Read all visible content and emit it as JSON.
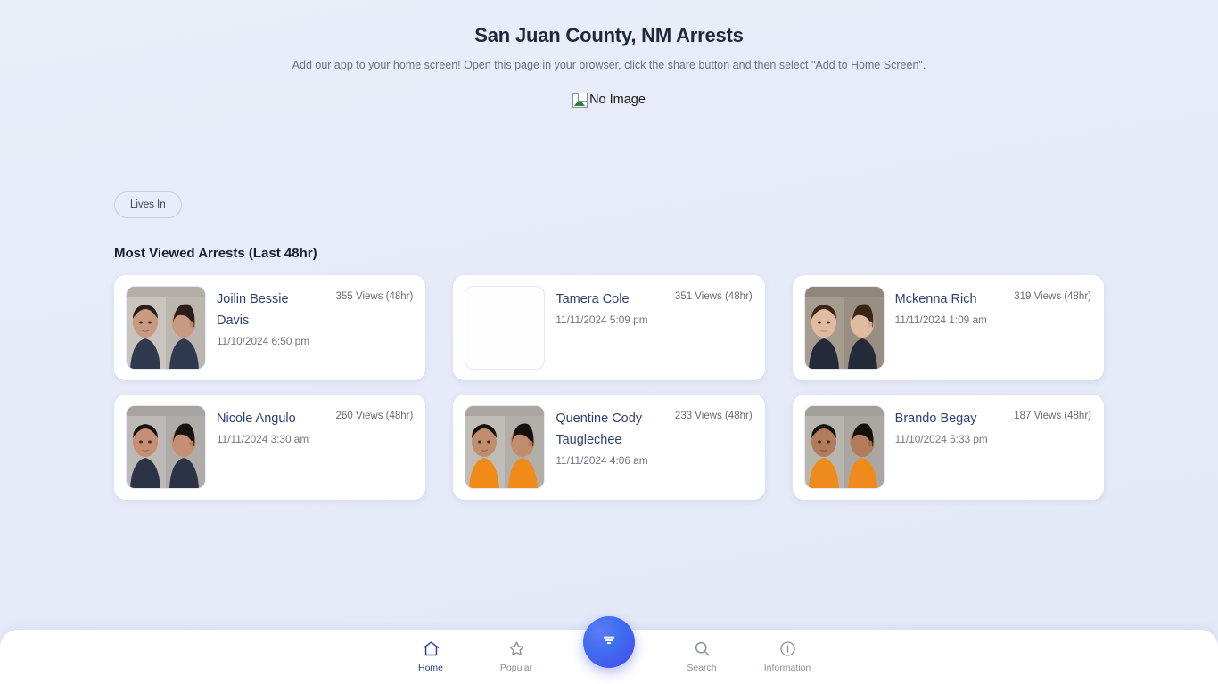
{
  "header": {
    "title": "San Juan County, NM Arrests",
    "subtitle": "Add our app to your home screen! Open this page in your browser, click the share button and then select \"Add to Home Screen\"."
  },
  "ad_slot": {
    "alt_text": "No Image",
    "icon": "broken-image-icon"
  },
  "filters": {
    "chips": [
      {
        "label": "Lives In"
      }
    ]
  },
  "section": {
    "heading": "Most Viewed Arrests (Last 48hr)"
  },
  "arrests": [
    {
      "name": "Joilin Bessie Davis",
      "date": "11/10/2024 6:50 pm",
      "views": "355 Views (48hr)",
      "has_image": true,
      "skin": "#c99a82",
      "hair": "#2b1d17",
      "clothing": "#2f3a50",
      "wall": "#c9c4be"
    },
    {
      "name": "Tamera Cole",
      "date": "11/11/2024 5:09 pm",
      "views": "351 Views (48hr)",
      "has_image": false,
      "skin": "",
      "hair": "",
      "clothing": "",
      "wall": ""
    },
    {
      "name": "Mckenna Rich",
      "date": "11/11/2024 1:09 am",
      "views": "319 Views (48hr)",
      "has_image": true,
      "skin": "#e0bb9f",
      "hair": "#3a2418",
      "clothing": "#232a39",
      "wall": "#a69c90"
    },
    {
      "name": "Nicole Angulo",
      "date": "11/11/2024 3:30 am",
      "views": "260 Views (48hr)",
      "has_image": true,
      "skin": "#c68f74",
      "hair": "#191310",
      "clothing": "#2b3347",
      "wall": "#bdb9b6"
    },
    {
      "name": "Quentine Cody Tauglechee",
      "date": "11/11/2024 4:06 am",
      "views": "233 Views (48hr)",
      "has_image": true,
      "skin": "#c08e6e",
      "hair": "#15100d",
      "clothing": "#f08a18",
      "wall": "#c0bcb8"
    },
    {
      "name": "Brando Begay",
      "date": "11/10/2024 5:33 pm",
      "views": "187 Views (48hr)",
      "has_image": true,
      "skin": "#b07c5c",
      "hair": "#14100c",
      "clothing": "#ef8a1c",
      "wall": "#b8b4b0"
    }
  ],
  "bottom_nav": {
    "items": [
      {
        "label": "Home",
        "icon": "home-icon",
        "active": true
      },
      {
        "label": "Popular",
        "icon": "star-icon",
        "active": false
      },
      {
        "label": "Search",
        "icon": "search-icon",
        "active": false
      },
      {
        "label": "Information",
        "icon": "info-icon",
        "active": false
      }
    ],
    "fab": {
      "icon": "filter-icon"
    }
  },
  "colors": {
    "accent": "#2f3f9e",
    "fab_start": "#5b7cf5",
    "fab_end": "#4a47e8",
    "link": "#2f3f73",
    "muted": "#6e7480",
    "background": "#e8ecf8"
  }
}
